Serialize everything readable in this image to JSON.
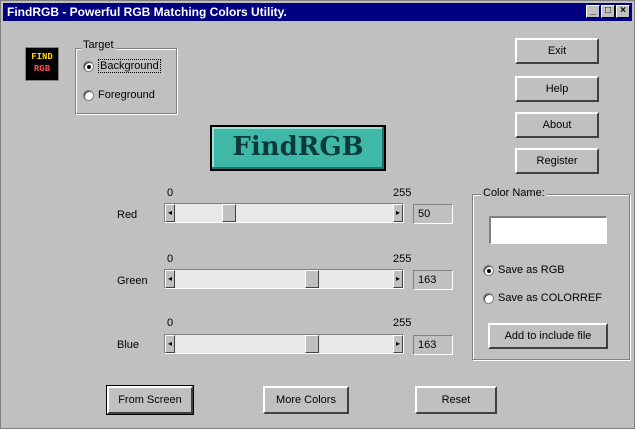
{
  "window": {
    "title": "FindRGB - Powerful RGB Matching Colors Utility.",
    "min_glyph": "_",
    "max_glyph": "□",
    "close_glyph": "×"
  },
  "logo": {
    "line1": "FIND",
    "line2": "RGB"
  },
  "target": {
    "label": "Target",
    "options": [
      {
        "label": "Background",
        "selected": true
      },
      {
        "label": "Foreground",
        "selected": false
      }
    ]
  },
  "banner": {
    "text": "FindRGB",
    "color": "#40b8a8"
  },
  "buttons": {
    "exit": "Exit",
    "help": "Help",
    "about": "About",
    "register": "Register",
    "from_screen": "From Screen",
    "more_colors": "More Colors",
    "reset": "Reset",
    "add_include": "Add to include file"
  },
  "sliders": {
    "min_label": "0",
    "max_label": "255",
    "red": {
      "label": "Red",
      "value": "50"
    },
    "green": {
      "label": "Green",
      "value": "163"
    },
    "blue": {
      "label": "Blue",
      "value": "163"
    }
  },
  "color_name": {
    "label": "Color Name:",
    "value": "",
    "save_options": [
      {
        "label": "Save as RGB",
        "selected": true
      },
      {
        "label": "Save as COLORREF",
        "selected": false
      }
    ]
  },
  "icons": {
    "left_arrow": "◂",
    "right_arrow": "▸"
  }
}
